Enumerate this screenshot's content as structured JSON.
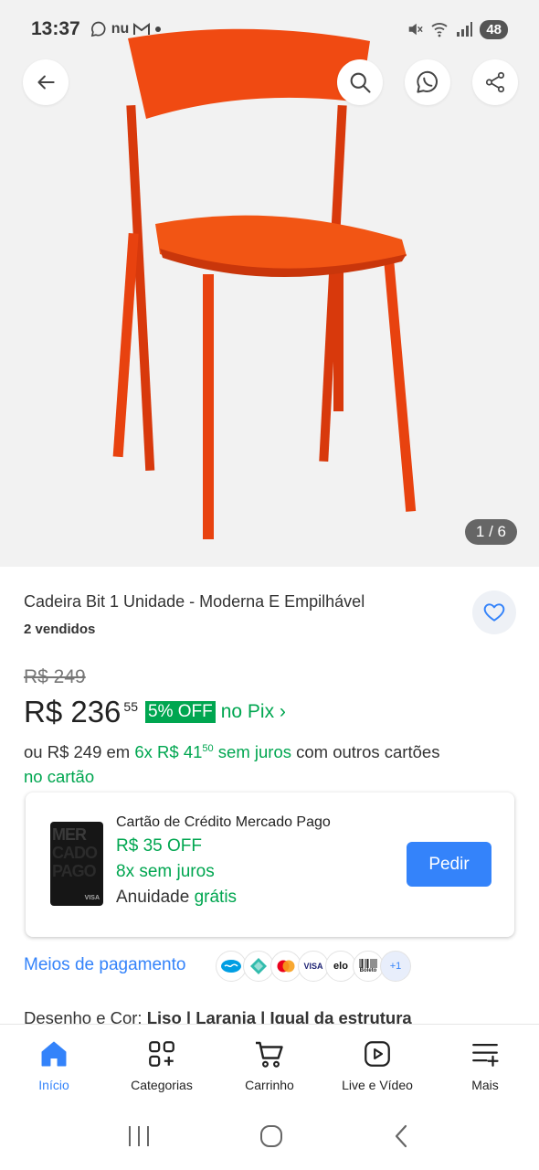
{
  "status_bar": {
    "time": "13:37",
    "left_icons": [
      "whatsapp-icon",
      "nu-icon",
      "gmail-icon",
      "dot-icon"
    ],
    "nu_text": "nu",
    "battery": "48"
  },
  "gallery": {
    "counter": "1 / 6"
  },
  "product": {
    "title": "Cadeira Bit 1 Unidade - Moderna E Empilhável",
    "sold": "2 vendidos",
    "old_price": "R$ 249",
    "price_main": "R$ 236",
    "price_cents": "55",
    "discount_badge": "5% OFF",
    "pix_text": "no Pix ›",
    "inst_prefix": "ou R$ 249 em ",
    "inst_green_a": "6x R$ 41",
    "inst_cents": "50",
    "inst_green_b": " sem juros",
    "inst_suffix": " com outros cartões",
    "inst_line2": "no cartão"
  },
  "credit_card": {
    "title": "Cartão de Crédito Mercado Pago",
    "off": "R$ 35 OFF",
    "juros": "8x sem juros",
    "anuidade_prefix": "Anuidade ",
    "anuidade_green": "grátis",
    "button": "Pedir",
    "card_words": [
      "MER",
      "CADO",
      "PAGO"
    ],
    "card_brand": "VISA"
  },
  "payment": {
    "label": "Meios de pagamento",
    "methods": [
      "mercado-pago",
      "pix",
      "mastercard",
      "visa",
      "elo",
      "boleto"
    ],
    "visa": "VISA",
    "elo": "elo",
    "boleto": "Boleto",
    "more": "+1"
  },
  "description": {
    "text_prefix": "Desenho e Cor: ",
    "text_bold": "Liso | Laranja | Igual da estrutura"
  },
  "bottom_nav": [
    {
      "label": "Início",
      "icon": "home-icon",
      "active": true
    },
    {
      "label": "Categorias",
      "icon": "categories-icon",
      "active": false
    },
    {
      "label": "Carrinho",
      "icon": "cart-icon",
      "active": false
    },
    {
      "label": "Live e Vídeo",
      "icon": "play-icon",
      "active": false
    },
    {
      "label": "Mais",
      "icon": "menu-plus-icon",
      "active": false
    }
  ],
  "colors": {
    "accent_blue": "#3483fa",
    "green": "#00a650",
    "chair_orange": "#f04a12"
  }
}
